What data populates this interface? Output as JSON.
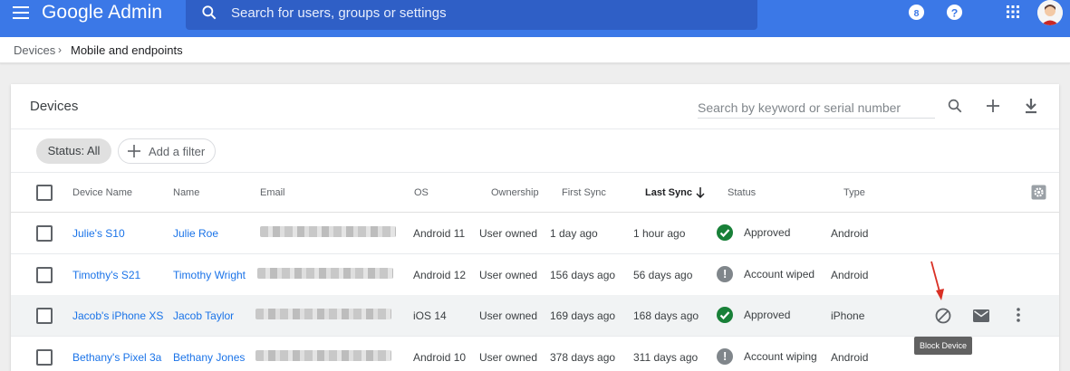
{
  "app": {
    "title": "Google Admin",
    "search_placeholder": "Search for users, groups or settings"
  },
  "topbar_icons": [
    "help-badge-icon",
    "help-icon",
    "apps-grid-icon",
    "avatar"
  ],
  "breadcrumb": {
    "parent": "Devices",
    "separator": "›",
    "current": "Mobile and endpoints"
  },
  "card": {
    "title": "Devices",
    "search_placeholder": "Search by keyword or serial number",
    "status_chip": "Status: All",
    "add_filter": "Add a filter"
  },
  "table": {
    "headers": {
      "device_name": "Device Name",
      "name": "Name",
      "email": "Email",
      "os": "OS",
      "ownership": "Ownership",
      "first_sync": "First Sync",
      "last_sync": "Last Sync",
      "status": "Status",
      "type": "Type"
    },
    "sorted_column": "last_sync",
    "rows": [
      {
        "device": "Julie's S10",
        "name": "Julie Roe",
        "os": "Android 11",
        "ownership": "User owned",
        "first_sync": "1 day ago",
        "last_sync": "1 hour ago",
        "status": "Approved",
        "type": "Android"
      },
      {
        "device": "Timothy's S21",
        "name": "Timothy Wright",
        "os": "Android 12",
        "ownership": "User owned",
        "first_sync": "156 days ago",
        "last_sync": "56 days ago",
        "status": "Account wiped",
        "type": "Android"
      },
      {
        "device": "Jacob's iPhone XS",
        "name": "Jacob Taylor",
        "os": "iOS 14",
        "ownership": "User owned",
        "first_sync": "169 days ago",
        "last_sync": "168 days ago",
        "status": "Approved",
        "type": "iPhone"
      },
      {
        "device": "Bethany's Pixel 3a",
        "name": "Bethany Jones",
        "os": "Android 10",
        "ownership": "User owned",
        "first_sync": "378 days ago",
        "last_sync": "311 days ago",
        "status": "Account wiping",
        "type": "Android"
      }
    ]
  },
  "tooltip": "Block Device",
  "colors": {
    "brand": "#3b78e7",
    "link": "#1a73e8",
    "approved": "#188038",
    "annotation": "#d93025"
  }
}
